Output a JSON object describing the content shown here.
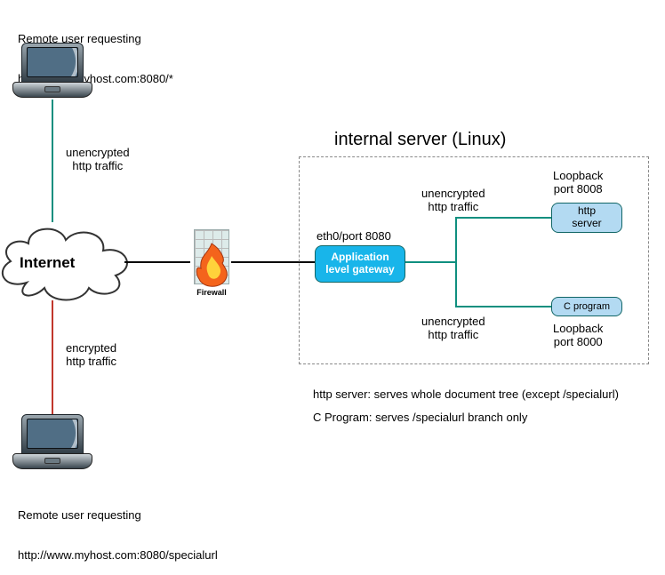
{
  "topUser": {
    "caption1": "Remote user requesting",
    "caption2": "http://www.myhost.com:8080/*"
  },
  "bottomUser": {
    "caption1": "Remote user requesting",
    "caption2": "http://www.myhost.com:8080/specialurl"
  },
  "edges": {
    "topTraffic": "unencrypted\nhttp traffic",
    "bottomTraffic": "encrypted\nhttp traffic",
    "upperInternal": "unencrypted\nhttp traffic",
    "lowerInternal": "unencrypted\nhttp traffic"
  },
  "cloud": {
    "label": "Internet"
  },
  "firewall": {
    "label": "Firewall"
  },
  "server": {
    "title": "internal server (Linux)",
    "portLabel": "eth0/port 8080",
    "gateway": "Application\nlevel gateway",
    "httpServer": {
      "label": "http\nserver",
      "portLabel": "Loopback\nport 8008"
    },
    "cProgram": {
      "label": "C program",
      "portLabel": "Loopback\nport 8000"
    }
  },
  "notes": {
    "line1": "http server: serves whole document tree (except /specialurl)",
    "line2": "C Program: serves /specialurl branch only"
  }
}
